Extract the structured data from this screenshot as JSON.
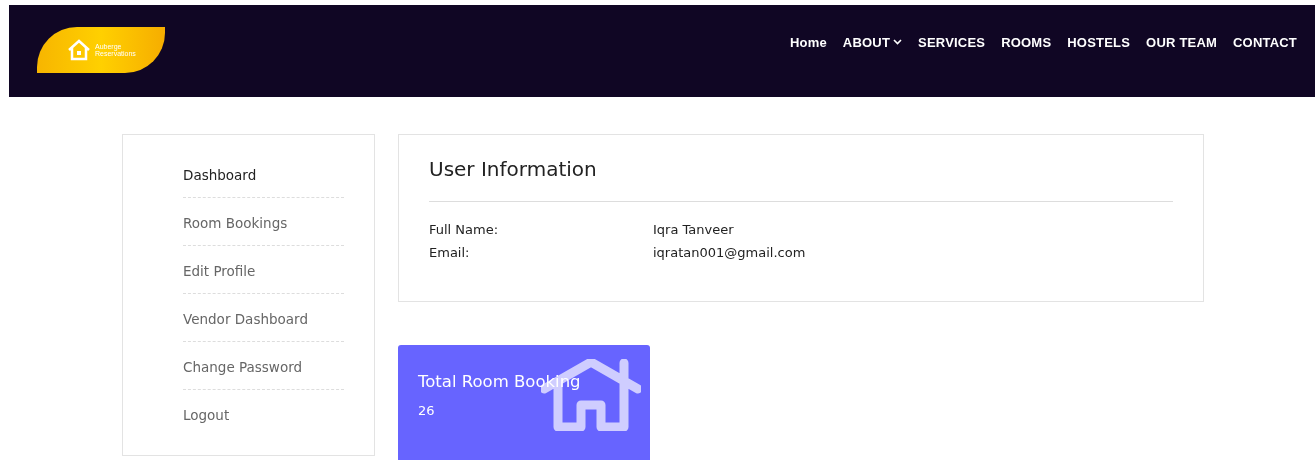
{
  "header": {
    "logo": {
      "line_1": "Auberge",
      "line_2": "Reservations"
    },
    "nav": [
      {
        "label": "Home",
        "dropdown": false
      },
      {
        "label": "ABOUT",
        "dropdown": true
      },
      {
        "label": "SERVICES",
        "dropdown": false
      },
      {
        "label": "ROOMS",
        "dropdown": false
      },
      {
        "label": "HOSTELS",
        "dropdown": false
      },
      {
        "label": "OUR TEAM",
        "dropdown": false
      },
      {
        "label": "CONTACT",
        "dropdown": false
      }
    ]
  },
  "sidebar": {
    "items": [
      {
        "label": "Dashboard",
        "selected": true
      },
      {
        "label": "Room Bookings",
        "selected": false
      },
      {
        "label": "Edit Profile",
        "selected": false
      },
      {
        "label": "Vendor Dashboard",
        "selected": false
      },
      {
        "label": "Change Password",
        "selected": false
      },
      {
        "label": "Logout",
        "selected": false
      }
    ]
  },
  "user_info": {
    "title": "User Information",
    "fields": [
      {
        "label": "Full Name:",
        "value": "Iqra Tanveer"
      },
      {
        "label": "Email:",
        "value": "iqratan001@gmail.com"
      }
    ]
  },
  "stat_card": {
    "title": "Total Room Booking",
    "value": "26"
  }
}
